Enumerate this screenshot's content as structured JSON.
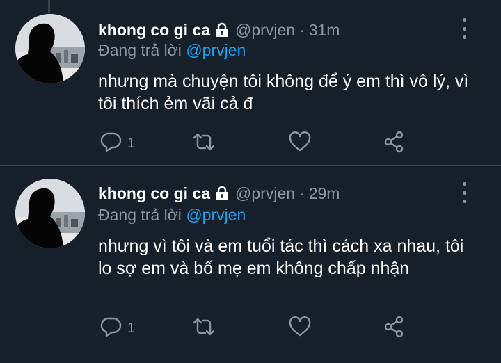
{
  "colors": {
    "background": "#15202b",
    "primary_text": "#ffffff",
    "secondary_text": "#8899a6",
    "link": "#1da1f2",
    "divider": "#38444d"
  },
  "tweets": [
    {
      "display_name": "khong co gi ca",
      "protected_icon": "lock-icon",
      "handle": "@prvjen",
      "separator": "·",
      "time": "31m",
      "replying_prefix": "Đang trả lời",
      "replying_to": "@prvjen",
      "text": "nhưng mà chuyện tôi không để ý em thì vô lý, vì tôi thích ẻm vãi cả đ",
      "reply_count": "1",
      "icons": {
        "reply": "reply-icon",
        "retweet": "retweet-icon",
        "like": "heart-icon",
        "share": "share-icon",
        "more": "more-vertical-icon"
      }
    },
    {
      "display_name": "khong co gi ca",
      "protected_icon": "lock-icon",
      "handle": "@prvjen",
      "separator": "·",
      "time": "29m",
      "replying_prefix": "Đang trả lời",
      "replying_to": "@prvjen",
      "text": "nhưng vì tôi và em tuổi tác thì cách xa nhau, tôi lo sợ em và bố mẹ em không chấp nhận",
      "reply_count": "1",
      "icons": {
        "reply": "reply-icon",
        "retweet": "retweet-icon",
        "like": "heart-icon",
        "share": "share-icon",
        "more": "more-vertical-icon"
      }
    }
  ]
}
